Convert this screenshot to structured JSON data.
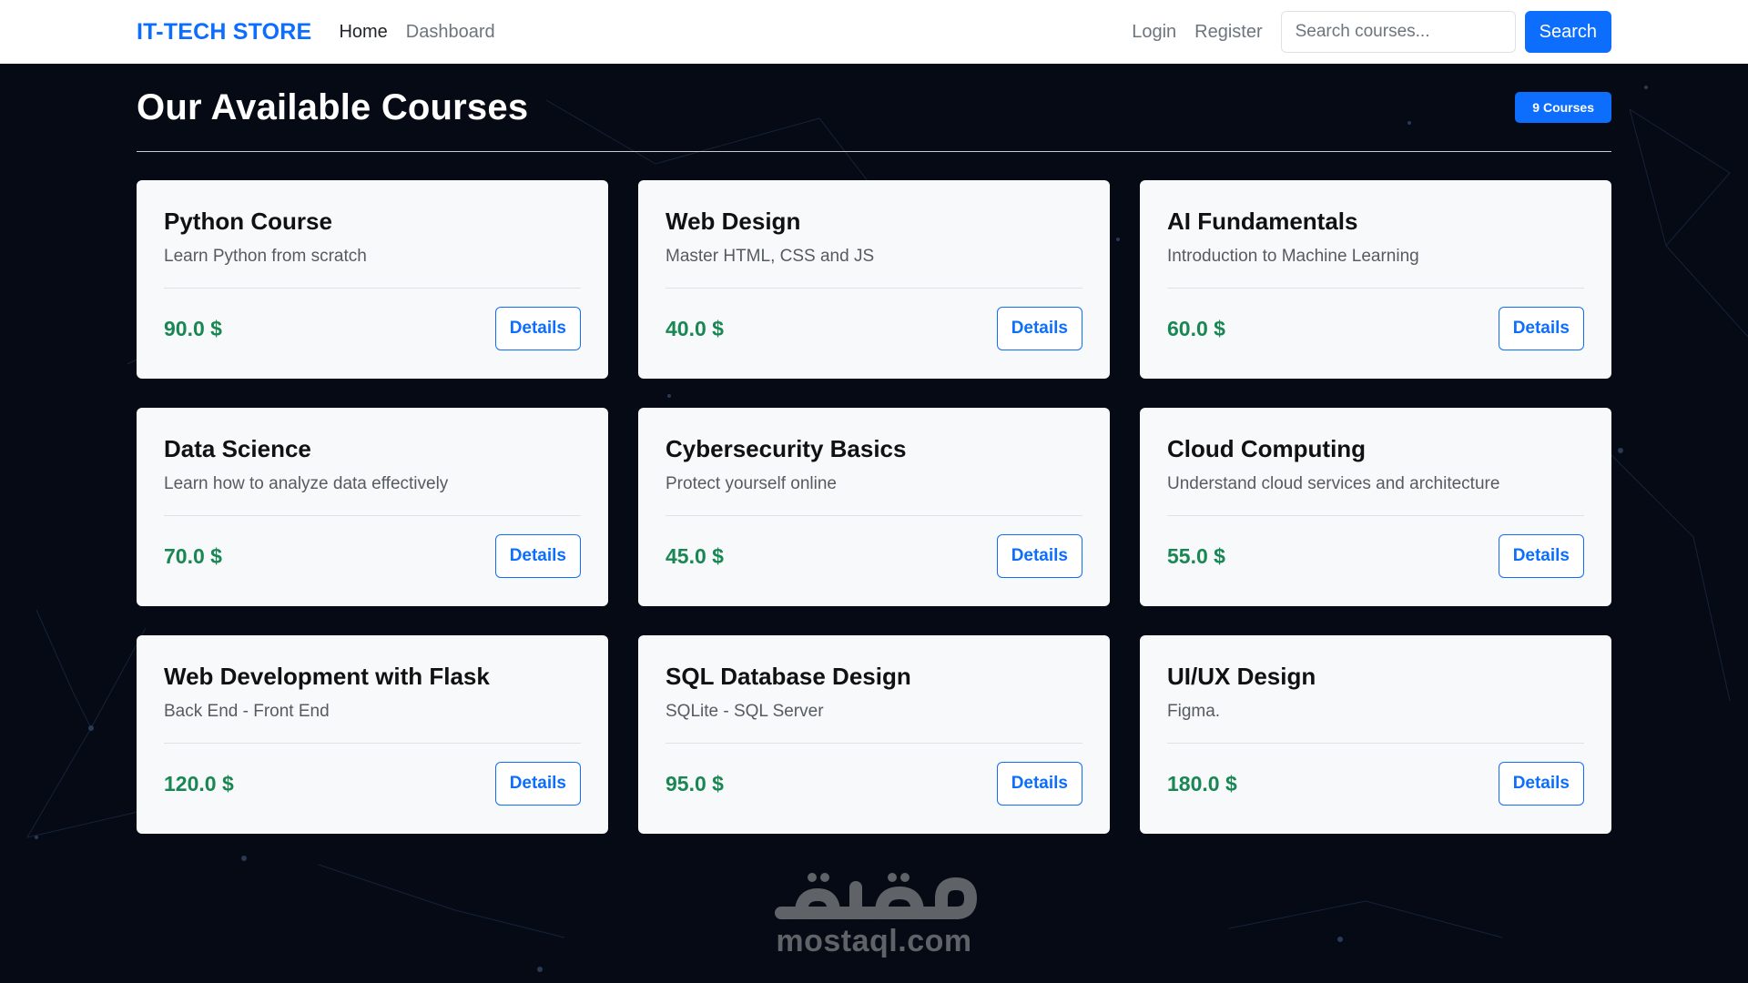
{
  "navbar": {
    "brand": "IT-TECH STORE",
    "links": [
      "Home",
      "Dashboard"
    ],
    "right_links": [
      "Login",
      "Register"
    ],
    "search_placeholder": "Search courses...",
    "search_button": "Search"
  },
  "main": {
    "title": "Our Available Courses",
    "count_badge": "9 Courses",
    "courses": [
      {
        "title": "Python Course",
        "description": "Learn Python from scratch",
        "price": "90.0 $",
        "button": "Details"
      },
      {
        "title": "Web Design",
        "description": "Master HTML, CSS and JS",
        "price": "40.0 $",
        "button": "Details"
      },
      {
        "title": "AI Fundamentals",
        "description": "Introduction to Machine Learning",
        "price": "60.0 $",
        "button": "Details"
      },
      {
        "title": "Data Science",
        "description": "Learn how to analyze data effectively",
        "price": "70.0 $",
        "button": "Details"
      },
      {
        "title": "Cybersecurity Basics",
        "description": "Protect yourself online",
        "price": "45.0 $",
        "button": "Details"
      },
      {
        "title": "Cloud Computing",
        "description": "Understand cloud services and architecture",
        "price": "55.0 $",
        "button": "Details"
      },
      {
        "title": "Web Development with Flask",
        "description": "Back End - Front End",
        "price": "120.0 $",
        "button": "Details"
      },
      {
        "title": "SQL Database Design",
        "description": "SQLite - SQL Server",
        "price": "95.0 $",
        "button": "Details"
      },
      {
        "title": "UI/UX Design",
        "description": "Figma.",
        "price": "180.0 $",
        "button": "Details"
      }
    ]
  },
  "watermark": {
    "text": "mostaql.com",
    "logo_text": "مستقل"
  },
  "colors": {
    "accent": "#0d6efd",
    "price": "#198754",
    "background": "#050a14",
    "card": "#f8f9fa"
  }
}
